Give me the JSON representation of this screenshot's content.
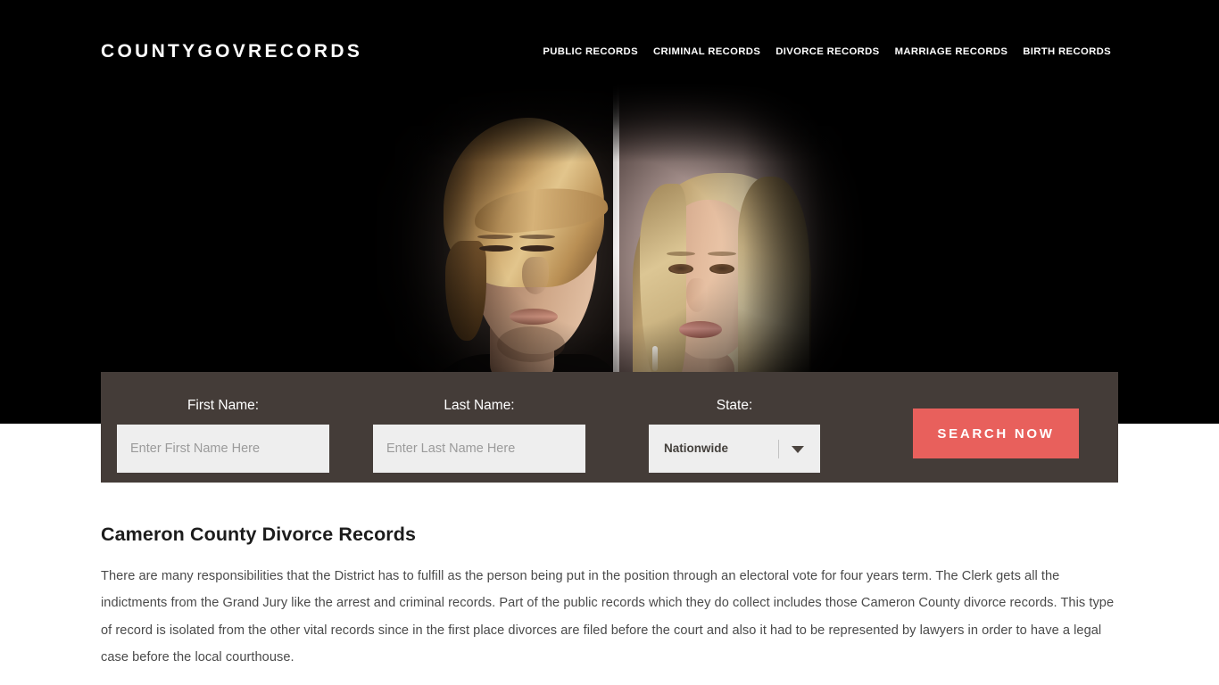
{
  "header": {
    "logo": "COUNTYGOVRECORDS",
    "nav": [
      {
        "label": "PUBLIC RECORDS"
      },
      {
        "label": "CRIMINAL RECORDS"
      },
      {
        "label": "DIVORCE RECORDS"
      },
      {
        "label": "MARRIAGE RECORDS"
      },
      {
        "label": "BIRTH RECORDS"
      }
    ]
  },
  "hero": {
    "image_alt": "Couple facing away from each other separated by a mirror seam"
  },
  "search_form": {
    "first_name": {
      "label": "First Name:",
      "placeholder": "Enter First Name Here",
      "value": ""
    },
    "last_name": {
      "label": "Last Name:",
      "placeholder": "Enter Last Name Here",
      "value": ""
    },
    "state": {
      "label": "State:",
      "selected": "Nationwide"
    },
    "submit_label": "SEARCH NOW"
  },
  "content": {
    "title": "Cameron County Divorce Records",
    "paragraph": "There are many responsibilities that the District has to fulfill as the person being put in the position through an electoral vote for four years term. The Clerk gets all the indictments from the Grand Jury like the arrest and criminal records. Part of the public records which they do collect includes those Cameron County divorce records. This type of record is isolated from the other vital records since in the first place divorces are filed before the court and also it had to be represented by lawyers in order to have a legal case before the local courthouse."
  },
  "colors": {
    "header_bg": "#000000",
    "form_bar_bg": "#443c38",
    "input_bg": "#eeeeee",
    "accent_button": "#e8605c",
    "page_bg": "#ffffff",
    "body_text": "#4a4a4a",
    "title_text": "#1c1c1c"
  }
}
